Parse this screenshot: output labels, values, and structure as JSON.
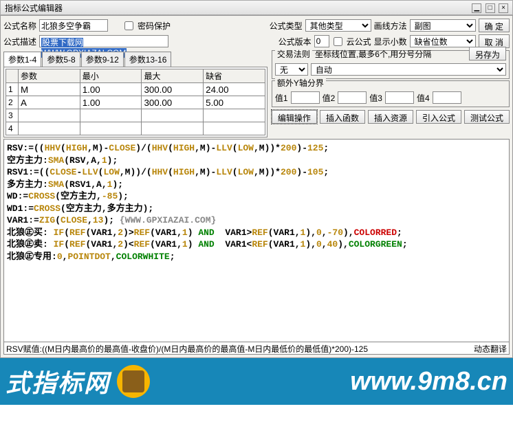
{
  "title": "指标公式编辑器",
  "labels": {
    "name": "公式名称",
    "pwd": "密码保护",
    "type": "公式类型",
    "draw": "画线方法",
    "desc": "公式描述",
    "ver": "公式版本",
    "cloud": "云公式",
    "dec": "显示小数",
    "ok": "确  定",
    "cancel": "取  消",
    "saveas": "另存为"
  },
  "values": {
    "name": "北狼多空争霸",
    "desc": "股票下载网WWW.GPXIAZAI.COM",
    "type": "其他类型",
    "draw": "副图",
    "ver": "0",
    "dec": "缺省位数"
  },
  "tabs": [
    "参数1-4",
    "参数5-8",
    "参数9-12",
    "参数13-16"
  ],
  "gridHeaders": [
    "",
    "参数",
    "最小",
    "最大",
    "缺省"
  ],
  "gridRows": [
    {
      "n": "1",
      "p": "M",
      "min": "1.00",
      "max": "300.00",
      "def": "24.00"
    },
    {
      "n": "2",
      "p": "A",
      "min": "1.00",
      "max": "300.00",
      "def": "5.00"
    },
    {
      "n": "3",
      "p": "",
      "min": "",
      "max": "",
      "def": ""
    },
    {
      "n": "4",
      "p": "",
      "min": "",
      "max": "",
      "def": ""
    }
  ],
  "rule": {
    "legend": "交易法则",
    "hint": "坐标线位置,最多6个,用分号分隔",
    "sel1": "无",
    "sel2": "自动"
  },
  "extra": {
    "legend": "额外Y轴分界",
    "v1": "值1",
    "v2": "值2",
    "v3": "值3",
    "v4": "值4"
  },
  "toolbar": [
    "编辑操作",
    "插入函数",
    "插入资源",
    "引入公式",
    "测试公式"
  ],
  "status": {
    "left": "RSV赋值:((M日内最高价的最高值-收盘价)/(M日内最高价的最高值-M日内最低价的最低值)*200)-125",
    "right": "动态翻译"
  },
  "banner": {
    "left": "式指标网",
    "right": "www.9m8.cn"
  },
  "code_lines": [
    [
      [
        "",
        "RSV:=(("
      ],
      [
        "fn",
        "HHV"
      ],
      [
        "",
        "("
      ],
      [
        "fn",
        "HIGH"
      ],
      [
        "",
        ",M)-"
      ],
      [
        "fn",
        "CLOSE"
      ],
      [
        "",
        ")/("
      ],
      [
        "fn",
        "HHV"
      ],
      [
        "",
        "("
      ],
      [
        "fn",
        "HIGH"
      ],
      [
        "",
        ",M)-"
      ],
      [
        "fn",
        "LLV"
      ],
      [
        "",
        "("
      ],
      [
        "fn",
        "LOW"
      ],
      [
        "",
        ",M))*"
      ],
      [
        "num",
        "200"
      ],
      [
        "",
        ")-"
      ],
      [
        "num",
        "125"
      ],
      [
        "",
        ";"
      ]
    ],
    [
      [
        "",
        "空方主力:"
      ],
      [
        "fn",
        "SMA"
      ],
      [
        "",
        "(RSV,A,"
      ],
      [
        "num",
        "1"
      ],
      [
        "",
        ");"
      ]
    ],
    [
      [
        "",
        "RSV1:=(("
      ],
      [
        "fn",
        "CLOSE"
      ],
      [
        "",
        "-"
      ],
      [
        "fn",
        "LLV"
      ],
      [
        "",
        "("
      ],
      [
        "fn",
        "LOW"
      ],
      [
        "",
        ",M))/("
      ],
      [
        "fn",
        "HHV"
      ],
      [
        "",
        "("
      ],
      [
        "fn",
        "HIGH"
      ],
      [
        "",
        ",M)-"
      ],
      [
        "fn",
        "LLV"
      ],
      [
        "",
        "("
      ],
      [
        "fn",
        "LOW"
      ],
      [
        "",
        ",M))*"
      ],
      [
        "num",
        "200"
      ],
      [
        "",
        ")-"
      ],
      [
        "num",
        "105"
      ],
      [
        "",
        ";"
      ]
    ],
    [
      [
        "",
        "多方主力:"
      ],
      [
        "fn",
        "SMA"
      ],
      [
        "",
        "(RSV1,A,"
      ],
      [
        "num",
        "1"
      ],
      [
        "",
        ");"
      ]
    ],
    [
      [
        "",
        "WD:="
      ],
      [
        "fn",
        "CROSS"
      ],
      [
        "",
        "(空方主力,"
      ],
      [
        "num",
        "-85"
      ],
      [
        "",
        ");"
      ]
    ],
    [
      [
        "",
        "WD1:="
      ],
      [
        "fn",
        "CROSS"
      ],
      [
        "",
        "(空方主力,多方主力);"
      ]
    ],
    [
      [
        "",
        "VAR1:="
      ],
      [
        "fn",
        "ZIG"
      ],
      [
        "",
        "("
      ],
      [
        "fn",
        "CLOSE"
      ],
      [
        "",
        ","
      ],
      [
        "num",
        "13"
      ],
      [
        "",
        "); "
      ],
      [
        "cmt",
        "{WWW.GPXIAZAI.COM}"
      ]
    ],
    [
      [
        "",
        "北狼㊣买: "
      ],
      [
        "fn",
        "IF"
      ],
      [
        "",
        "("
      ],
      [
        "fn",
        "REF"
      ],
      [
        "",
        "(VAR1,"
      ],
      [
        "num",
        "2"
      ],
      [
        "",
        ")>"
      ],
      [
        "fn",
        "REF"
      ],
      [
        "",
        "(VAR1,"
      ],
      [
        "num",
        "1"
      ],
      [
        "",
        ") "
      ],
      [
        "kw",
        "AND"
      ],
      [
        "",
        "  VAR1>"
      ],
      [
        "fn",
        "REF"
      ],
      [
        "",
        "(VAR1,"
      ],
      [
        "num",
        "1"
      ],
      [
        "",
        "),"
      ],
      [
        "num",
        "0"
      ],
      [
        "",
        ","
      ],
      [
        "num",
        "-70"
      ],
      [
        "",
        "),"
      ],
      [
        "red",
        "COLORRED"
      ],
      [
        "",
        ";"
      ]
    ],
    [
      [
        "",
        "北狼㊣卖: "
      ],
      [
        "fn",
        "IF"
      ],
      [
        "",
        "("
      ],
      [
        "fn",
        "REF"
      ],
      [
        "",
        "(VAR1,"
      ],
      [
        "num",
        "2"
      ],
      [
        "",
        ")<"
      ],
      [
        "fn",
        "REF"
      ],
      [
        "",
        "(VAR1,"
      ],
      [
        "num",
        "1"
      ],
      [
        "",
        ") "
      ],
      [
        "kw",
        "AND"
      ],
      [
        "",
        "  VAR1<"
      ],
      [
        "fn",
        "REF"
      ],
      [
        "",
        "(VAR1,"
      ],
      [
        "num",
        "1"
      ],
      [
        "",
        "),"
      ],
      [
        "num",
        "0"
      ],
      [
        "",
        ","
      ],
      [
        "num",
        "40"
      ],
      [
        "",
        "),"
      ],
      [
        "kw",
        "COLORGREEN"
      ],
      [
        "",
        ";"
      ]
    ],
    [
      [
        "",
        "北狼㊣专用:"
      ],
      [
        "num",
        "0"
      ],
      [
        "",
        ","
      ],
      [
        "fn",
        "POINTDOT"
      ],
      [
        "",
        ","
      ],
      [
        "kw",
        "COLORWHITE"
      ],
      [
        "",
        ";"
      ]
    ]
  ]
}
